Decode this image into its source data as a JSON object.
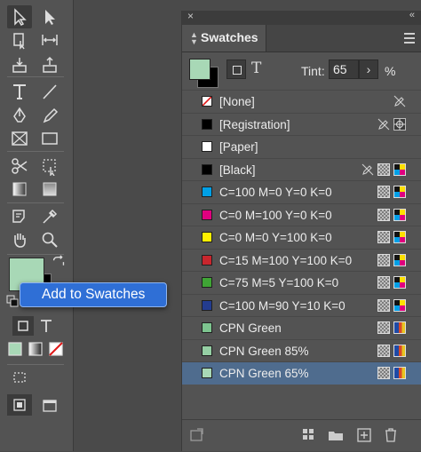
{
  "panel": {
    "title": "Swatches",
    "close_glyph": "×",
    "collapse_glyph": "«",
    "tint_label": "Tint:",
    "tint_value": "65",
    "tint_stepper_glyph": "›",
    "tint_percent": "%",
    "text_toggle_glyph": "T",
    "current_fill_color": "#a8d8b6"
  },
  "swatches": [
    {
      "name": "[None]",
      "color": "none",
      "icons": [
        "no-edit-pencil-icon"
      ]
    },
    {
      "name": "[Registration]",
      "color": "#000000",
      "icons": [
        "no-edit-pencil-icon",
        "registration-target-icon"
      ]
    },
    {
      "name": "[Paper]",
      "color": "#ffffff",
      "icons": []
    },
    {
      "name": "[Black]",
      "color": "#000000",
      "icons": [
        "no-edit-pencil-icon",
        "process-color-icon",
        "cmyk-mode-icon"
      ]
    },
    {
      "name": "C=100 M=0 Y=0 K=0",
      "color": "#00a0e6",
      "icons": [
        "process-color-icon",
        "cmyk-mode-icon"
      ]
    },
    {
      "name": "C=0 M=100 Y=0 K=0",
      "color": "#e0007f",
      "icons": [
        "process-color-icon",
        "cmyk-mode-icon"
      ]
    },
    {
      "name": "C=0 M=0 Y=100 K=0",
      "color": "#ffef00",
      "icons": [
        "process-color-icon",
        "cmyk-mode-icon"
      ]
    },
    {
      "name": "C=15 M=100 Y=100 K=0",
      "color": "#c8262d",
      "icons": [
        "process-color-icon",
        "cmyk-mode-icon"
      ]
    },
    {
      "name": "C=75 M=5 Y=100 K=0",
      "color": "#3fa535",
      "icons": [
        "process-color-icon",
        "cmyk-mode-icon"
      ]
    },
    {
      "name": "C=100 M=90 Y=10 K=0",
      "color": "#233c8f",
      "icons": [
        "process-color-icon",
        "cmyk-mode-icon"
      ]
    },
    {
      "name": "CPN Green",
      "color": "#7dc48f",
      "icons": [
        "process-color-icon",
        "rgb-mode-icon"
      ]
    },
    {
      "name": "CPN Green 85%",
      "color": "#95cfa4",
      "icons": [
        "process-color-icon",
        "rgb-mode-icon"
      ]
    },
    {
      "name": "CPN Green 65%",
      "color": "#a8d8b6",
      "icons": [
        "process-color-icon",
        "rgb-mode-icon"
      ],
      "selected": true
    }
  ],
  "toolbar": {
    "fill_color": "#a8d8b6",
    "stroke_color": "#000000",
    "popup_label": "Add to Swatches"
  },
  "bottom_buttons": [
    "place-swatch-icon",
    "swatch-views-icon",
    "new-color-group-icon",
    "new-swatch-icon",
    "delete-swatch-icon"
  ]
}
